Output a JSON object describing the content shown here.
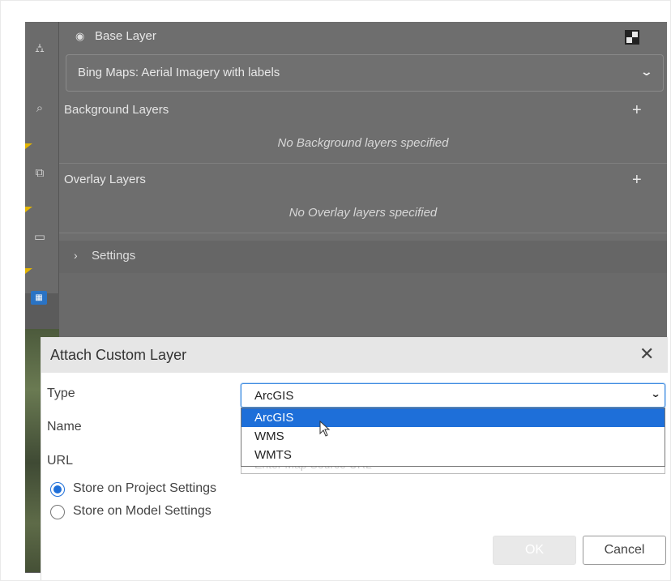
{
  "layer_panel": {
    "base_layer_label": "Base Layer",
    "base_layer_value": "Bing Maps: Aerial Imagery with labels",
    "background_title": "Background Layers",
    "background_empty": "No Background layers specified",
    "overlay_title": "Overlay Layers",
    "overlay_empty": "No Overlay layers specified",
    "settings_label": "Settings",
    "add_symbol": "+"
  },
  "dialog": {
    "title": "Attach Custom Layer",
    "close_symbol": "✕",
    "type_label": "Type",
    "name_label": "Name",
    "url_label": "URL",
    "type_value": "ArcGIS",
    "type_options": [
      "ArcGIS",
      "WMS",
      "WMTS"
    ],
    "selected_option_index": 0,
    "url_placeholder": "Enter Map Source URL",
    "storage_options": [
      {
        "label": "Store on Project Settings",
        "checked": true
      },
      {
        "label": "Store on Model Settings",
        "checked": false
      }
    ],
    "ok_label": "OK",
    "cancel_label": "Cancel"
  },
  "colors": {
    "accent": "#1e6fd9",
    "panel_overlay": "#6e6e6e",
    "dialog_header": "#e6e6e6"
  },
  "icons": {
    "toolbar": [
      "tree-icon",
      "search-icon",
      "shapes-icon",
      "comment-icon",
      "map-badge-icon"
    ],
    "base_layer": "eye-icon",
    "base_layer_toggle": "grid-toggle-icon"
  }
}
